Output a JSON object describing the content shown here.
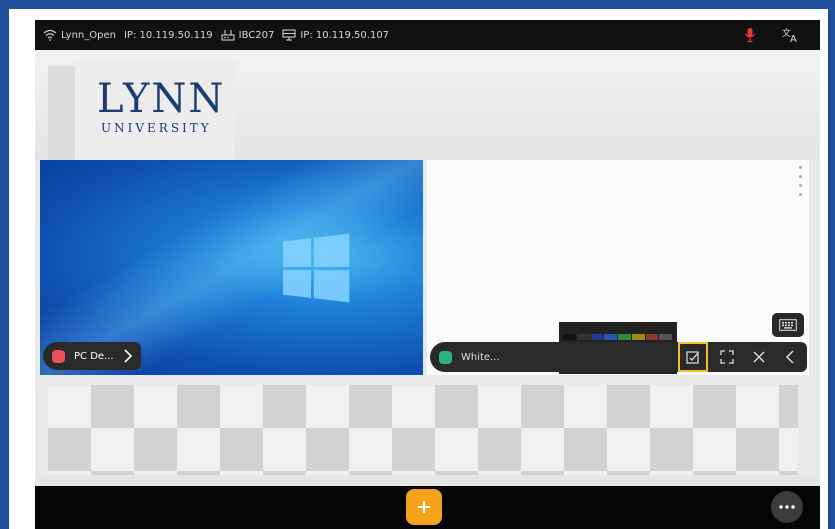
{
  "status_bar": {
    "wifi_name": "Lynn_Open",
    "wifi_ip": "IP: 10.119.50.119",
    "room": "IBC207",
    "display_ip": "IP: 10.119.50.107"
  },
  "background": {
    "logo_main": "LYNN",
    "logo_sub": "UNIVERSITY"
  },
  "windows": [
    {
      "label": "PC De...",
      "color": "#e8505b"
    },
    {
      "label": "White...",
      "color": "#2db37a"
    }
  ],
  "icons": {
    "wifi": "wifi-icon",
    "router": "router-icon",
    "display": "display-icon",
    "mic": "microphone-icon",
    "translate": "translate-icon",
    "keyboard": "keyboard-icon",
    "annotate": "annotate-icon",
    "fullscreen": "fullscreen-icon",
    "close": "close-icon",
    "collapse": "chevron-left-icon",
    "expand": "chevron-right-icon",
    "add": "plus-icon",
    "more": "more-icon"
  },
  "colors": {
    "accent": "#f4a21b",
    "highlight": "#f2c12e",
    "mic": "#e53935",
    "frame": "#1f4e9a"
  }
}
